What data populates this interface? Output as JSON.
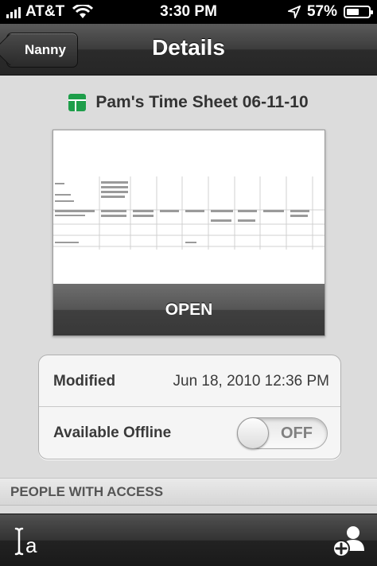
{
  "status_bar": {
    "carrier": "AT&T",
    "time": "3:30 PM",
    "battery": "57%",
    "battery_level": 0.57
  },
  "navbar": {
    "back_label": "Nanny",
    "title": "Details"
  },
  "document": {
    "title": "Pam's Time Sheet 06-11-10",
    "open_label": "OPEN",
    "icon": "spreadsheet-icon"
  },
  "details": {
    "modified_label": "Modified",
    "modified_value": "Jun 18, 2010 12:36 PM",
    "offline_label": "Available Offline",
    "offline_state": "OFF"
  },
  "section": {
    "people_header": "PEOPLE WITH ACCESS"
  },
  "toolbar": {
    "left_icon": "rename-icon",
    "right_icon": "add-person-icon"
  },
  "colors": {
    "sheet_icon": "#1e9e4a",
    "nav_bg": "#2b2b2b"
  }
}
